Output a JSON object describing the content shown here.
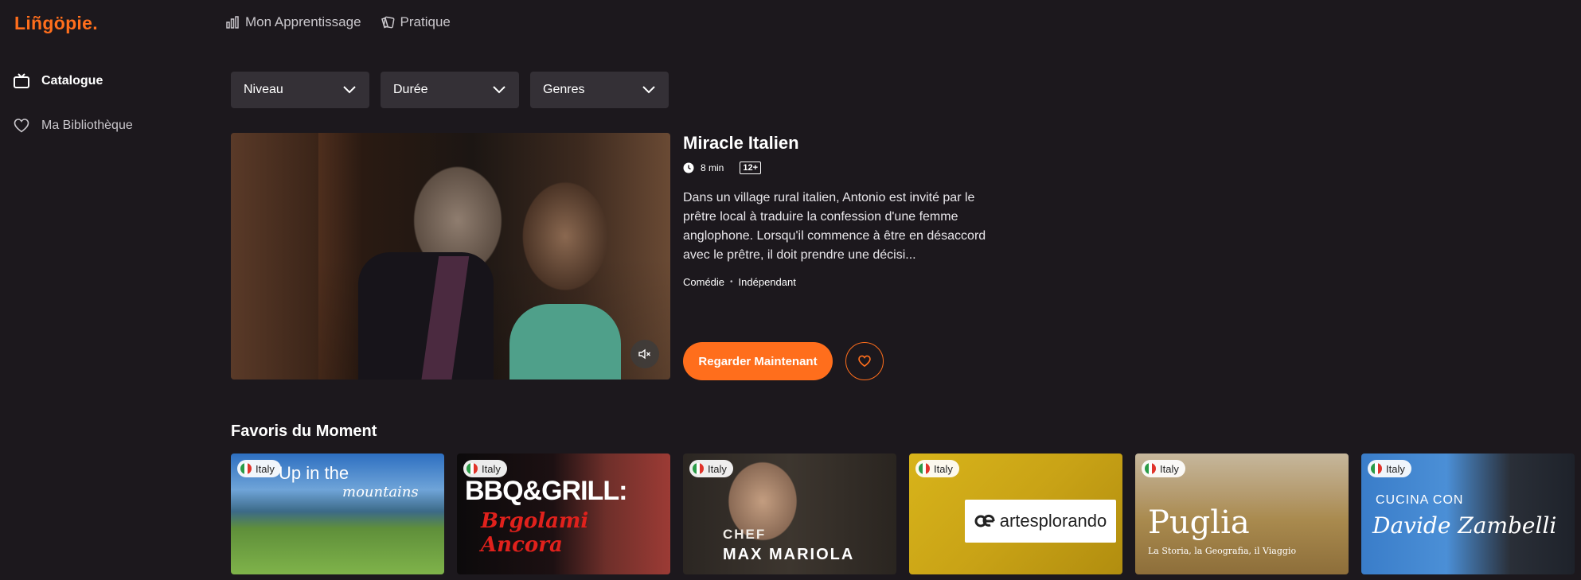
{
  "app": {
    "logo": "Liñgöpie."
  },
  "topnav": [
    {
      "label": "Mon Apprentissage",
      "icon": "bar-chart-icon"
    },
    {
      "label": "Pratique",
      "icon": "cards-icon"
    }
  ],
  "sidebar": {
    "items": [
      {
        "label": "Catalogue",
        "icon": "tv-icon",
        "active": true
      },
      {
        "label": "Ma Bibliothèque",
        "icon": "heart-icon",
        "active": false
      }
    ]
  },
  "filters": [
    {
      "label": "Niveau"
    },
    {
      "label": "Durée"
    },
    {
      "label": "Genres"
    }
  ],
  "hero": {
    "title": "Miracle Italien",
    "duration": "8 min",
    "rating": "12+",
    "description": "Dans un village rural italien, Antonio est invité par le prêtre local à traduire la confession d'une femme anglophone. Lorsqu'il commence à être en désaccord avec le prêtre, il doit prendre une décisi...",
    "genres": [
      "Comédie",
      "Indépendant"
    ],
    "genre_separator": "•",
    "watch_label": "Regarder Maintenant"
  },
  "favorites": {
    "title": "Favoris du Moment",
    "cards": [
      {
        "badge": "Italy",
        "text1": "Up in the",
        "text2": "mountains"
      },
      {
        "badge": "Italy",
        "text1": "BBQ&GRILL:",
        "text2": "Brgolami Ancora"
      },
      {
        "badge": "Italy",
        "text1": "CHEF",
        "text2": "MAX MARIOLA"
      },
      {
        "badge": "Italy",
        "text1": "artesplorando"
      },
      {
        "badge": "Italy",
        "text1": "Puglia",
        "text2": "La Storia, la Geografia, il Viaggio"
      },
      {
        "badge": "Italy",
        "text1": "CUCINA CON",
        "text2": "Davide Zambelli"
      }
    ]
  },
  "colors": {
    "accent": "#ff6e1c",
    "background": "#1c181d",
    "filter_bg": "#343036"
  }
}
